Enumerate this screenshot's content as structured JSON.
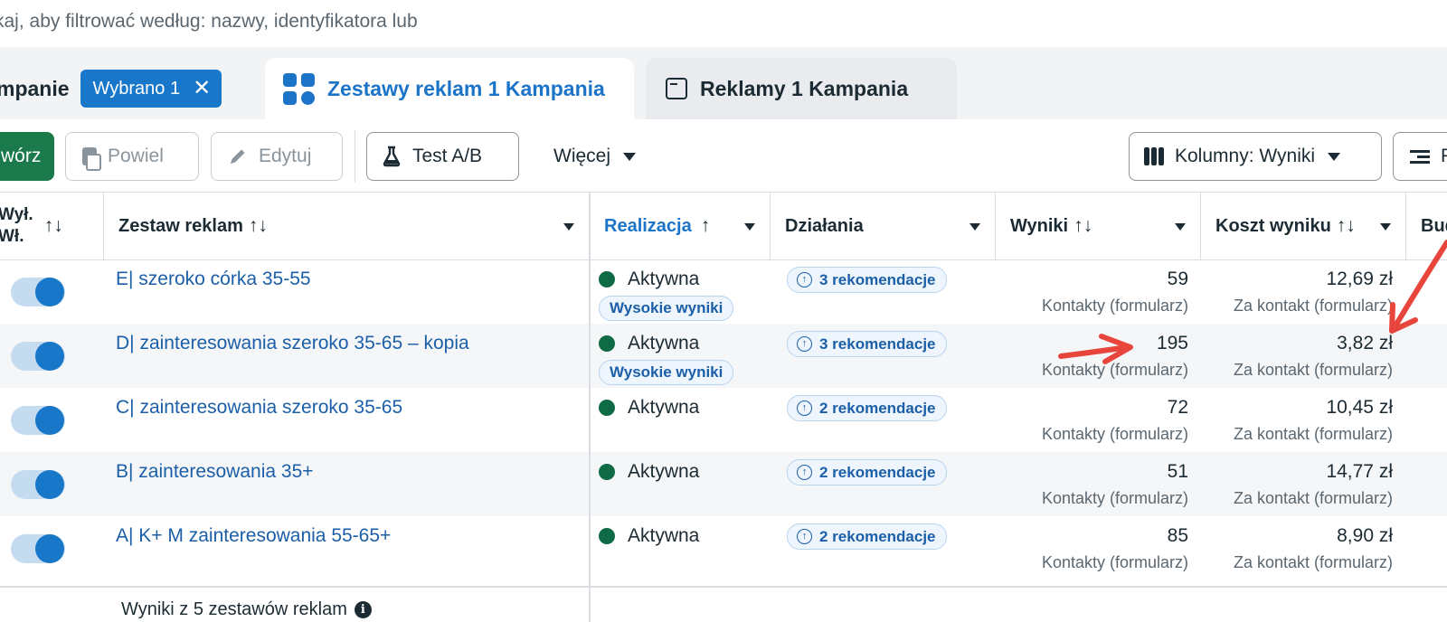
{
  "search": {
    "placeholder_visible": "kaj, aby filtrować według: nazwy, identyfikatora lub"
  },
  "tabs": {
    "campaigns": {
      "label": "mpanie",
      "selected_chip": "Wybrano 1",
      "chip_close": "✕"
    },
    "adsets": {
      "label": "Zestawy reklam 1 Kampania"
    },
    "ads": {
      "label": "Reklamy 1 Kampania"
    }
  },
  "toolbar": {
    "create_label": "wórz",
    "duplicate_label": "Powiel",
    "edit_label": "Edytuj",
    "ab_test_label": "Test A/B",
    "more_label": "Więcej",
    "columns_label": "Kolumny: Wyniki",
    "breakdown_label": "P"
  },
  "table": {
    "headers": {
      "toggle_line1": "Wył.",
      "toggle_line2": "Wł.",
      "name": "Zestaw reklam",
      "delivery": "Realizacja",
      "actions": "Działania",
      "results": "Wyniki",
      "cost": "Koszt wyniku",
      "budget": "Bud"
    },
    "sort_icons": {
      "both": "↑↓",
      "up": "↑"
    },
    "rows": [
      {
        "name": "E| szeroko córka 35-55",
        "status": "Aktywna",
        "badge": "Wysokie wyniki",
        "recs": "3 rekomendacje",
        "results": "59",
        "results_sub": "Kontakty (formularz)",
        "cost": "12,69 zł",
        "cost_sub": "Za kontakt (formularz)"
      },
      {
        "name": "D| zainteresowania szeroko 35-65 – kopia",
        "status": "Aktywna",
        "badge": "Wysokie wyniki",
        "recs": "3 rekomendacje",
        "results": "195",
        "results_sub": "Kontakty (formularz)",
        "cost": "3,82 zł",
        "cost_sub": "Za kontakt (formularz)"
      },
      {
        "name": "C| zainteresowania szeroko 35-65",
        "status": "Aktywna",
        "badge": "",
        "recs": "2 rekomendacje",
        "results": "72",
        "results_sub": "Kontakty (formularz)",
        "cost": "10,45 zł",
        "cost_sub": "Za kontakt (formularz)"
      },
      {
        "name": "B| zainteresowania 35+",
        "status": "Aktywna",
        "badge": "",
        "recs": "2 rekomendacje",
        "results": "51",
        "results_sub": "Kontakty (formularz)",
        "cost": "14,77 zł",
        "cost_sub": "Za kontakt (formularz)"
      },
      {
        "name": "A| K+ M zainteresowania 55-65+",
        "status": "Aktywna",
        "badge": "",
        "recs": "2 rekomendacje",
        "results": "85",
        "results_sub": "Kontakty (formularz)",
        "cost": "8,90 zł",
        "cost_sub": "Za kontakt (formularz)"
      }
    ],
    "summary": "Wyniki z 5 zestawów reklam",
    "info_glyph": "i"
  },
  "colors": {
    "accent": "#1877c9",
    "link": "#1b5fa8",
    "create_button": "#1b7a4b",
    "status_active": "#0f6b45",
    "annotation_arrow": "#e8453c"
  },
  "icons": {
    "close": "close-icon",
    "grid": "adsets-grid-icon",
    "window": "ads-window-icon",
    "duplicate": "duplicate-icon",
    "edit": "pencil-icon",
    "flask": "flask-icon",
    "columns": "columns-icon",
    "breakdown": "breakdown-icon",
    "info": "info-icon",
    "recommendation": "arrow-up-circle-icon"
  }
}
